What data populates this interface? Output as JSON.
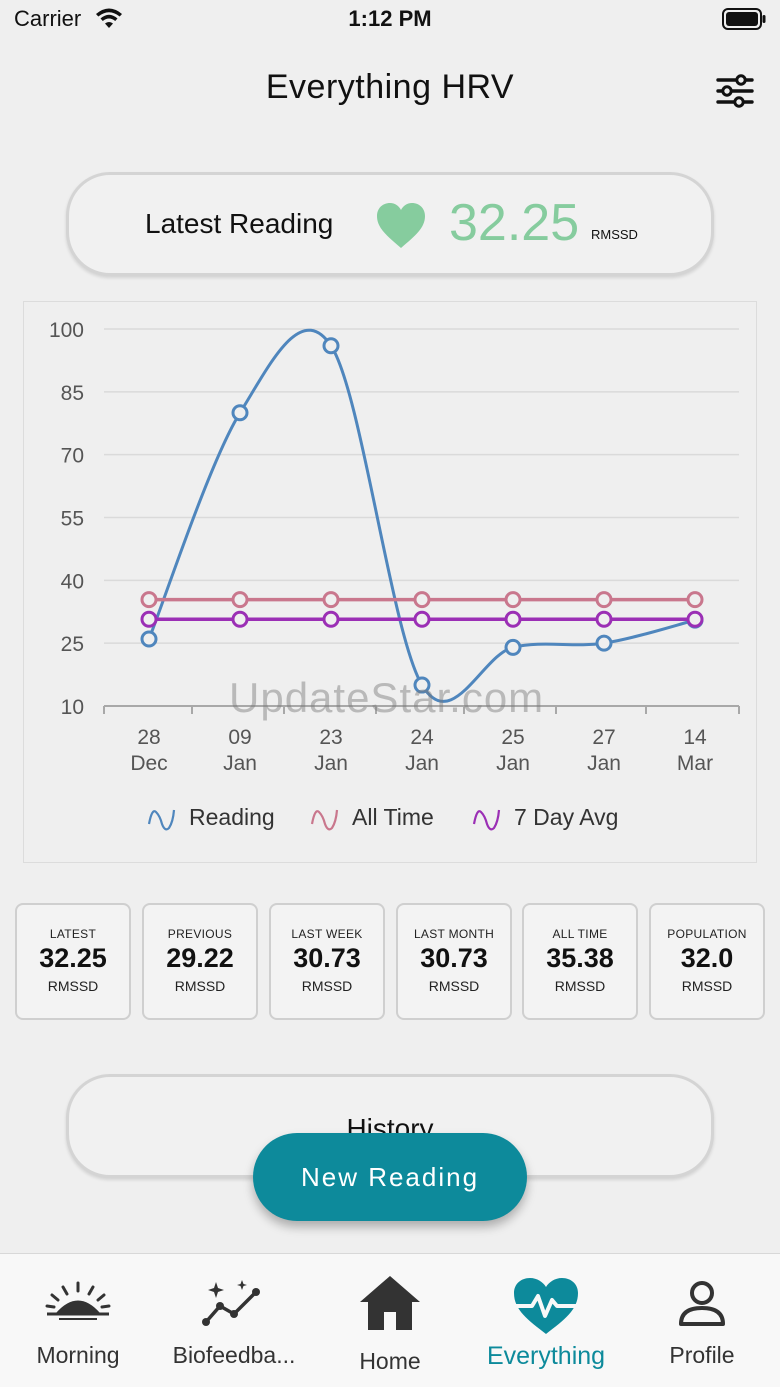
{
  "status_bar": {
    "carrier": "Carrier",
    "time": "1:12 PM"
  },
  "header": {
    "title": "Everything HRV"
  },
  "latest_reading": {
    "label": "Latest Reading",
    "value": "32.25",
    "unit": "RMSSD",
    "accent_color": "#86cc9e"
  },
  "chart_data": {
    "type": "line",
    "categories": [
      [
        "28",
        "Dec"
      ],
      [
        "09",
        "Jan"
      ],
      [
        "23",
        "Jan"
      ],
      [
        "24",
        "Jan"
      ],
      [
        "25",
        "Jan"
      ],
      [
        "27",
        "Jan"
      ],
      [
        "14",
        "Mar"
      ]
    ],
    "ylim": [
      10,
      100
    ],
    "yticks": [
      100,
      85,
      70,
      55,
      40,
      25,
      10
    ],
    "series": [
      {
        "name": "Reading",
        "color": "#4f86bd",
        "values": [
          26,
          80,
          96,
          15,
          24,
          25,
          30.5
        ]
      },
      {
        "name": "All Time",
        "color": "#c9778d",
        "values": [
          35.4,
          35.4,
          35.4,
          35.4,
          35.4,
          35.4,
          35.4
        ]
      },
      {
        "name": "7 Day Avg",
        "color": "#9b2fb5",
        "values": [
          30.7,
          30.7,
          30.7,
          30.7,
          30.7,
          30.7,
          30.7
        ]
      }
    ],
    "grid": true,
    "legend": "bottom",
    "watermark": "UpdateStar.com"
  },
  "stats": [
    {
      "label": "LATEST",
      "value": "32.25",
      "unit": "RMSSD"
    },
    {
      "label": "PREVIOUS",
      "value": "29.22",
      "unit": "RMSSD"
    },
    {
      "label": "LAST WEEK",
      "value": "30.73",
      "unit": "RMSSD"
    },
    {
      "label": "LAST MONTH",
      "value": "30.73",
      "unit": "RMSSD"
    },
    {
      "label": "ALL TIME",
      "value": "35.38",
      "unit": "RMSSD"
    },
    {
      "label": "POPULATION",
      "value": "32.0",
      "unit": "RMSSD"
    }
  ],
  "history": {
    "label": "History"
  },
  "new_reading": {
    "label": "New Reading",
    "color": "#0d8a9b"
  },
  "tabs": [
    {
      "label": "Morning",
      "icon": "sunrise-icon"
    },
    {
      "label": "Biofeedba...",
      "icon": "trend-sparkle-icon"
    },
    {
      "label": "Home",
      "icon": "house-icon"
    },
    {
      "label": "Everything",
      "icon": "heart-pulse-icon",
      "active": true,
      "active_color": "#0d8a9b"
    },
    {
      "label": "Profile",
      "icon": "person-icon"
    }
  ]
}
